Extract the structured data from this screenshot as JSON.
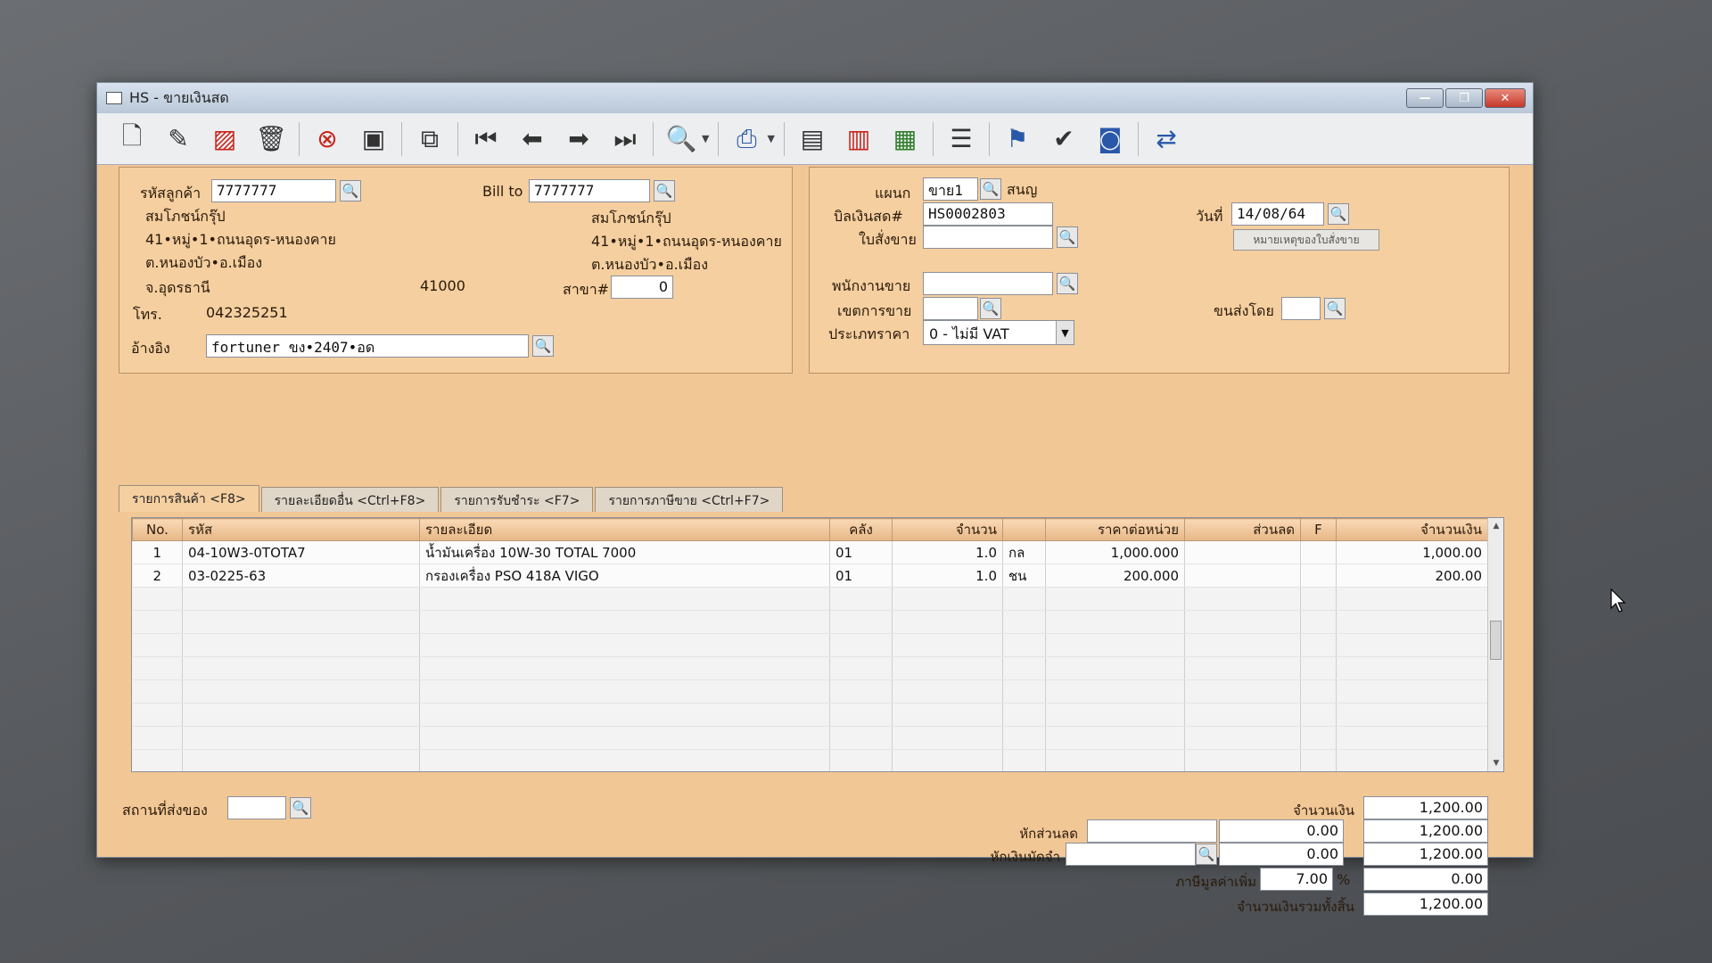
{
  "window": {
    "title": "HS - ขายเงินสด"
  },
  "toolbar": {
    "icons": [
      "new-icon",
      "edit-icon",
      "void-icon",
      "delete-icon",
      "cancel-icon",
      "save-icon",
      "copy-icon",
      "first-icon",
      "prev-icon",
      "next-icon",
      "last-icon",
      "search-icon",
      "print-icon",
      "calc-icon",
      "card-icon",
      "report-icon",
      "list-icon",
      "approve-icon",
      "checkmark-icon",
      "ok-icon",
      "transfer-icon"
    ]
  },
  "customer": {
    "code_label": "รหัสลูกค้า",
    "code": "7777777",
    "name": "สมโภชน์กรุ๊ป",
    "addr1": "41•หมู่•1•ถนนอุดร-หนองคาย",
    "addr2": "ต.หนองบัว•อ.เมือง",
    "province": "จ.อุดรธานี",
    "zip": "41000",
    "phone_label": "โทร.",
    "phone": "042325251",
    "ref_label": "อ้างอิง",
    "ref": "fortuner ขง•2407•อด"
  },
  "billto": {
    "label": "Bill to",
    "code": "7777777",
    "name": "สมโภชน์กรุ๊ป",
    "addr1": "41•หมู่•1•ถนนอุดร-หนองคาย",
    "addr2": "ต.หนองบัว•อ.เมือง",
    "branch_label": "สาขา#",
    "branch": "0"
  },
  "doc": {
    "dept_label": "แผนก",
    "dept": "ขาย1",
    "dept_name": "สนญ",
    "bill_label": "บิลเงินสด#",
    "bill": "HS0002803",
    "date_label": "วันที่",
    "date": "14/08/64",
    "so_label": "ใบสั่งขาย",
    "so_note_button": "หมายเหตุของใบสั่งขาย",
    "sales_label": "พนักงานขาย",
    "area_label": "เขตการขาย",
    "ship_label": "ขนส่งโดย",
    "price_type_label": "ประเภทราคา",
    "price_type": "0 - ไม่มี VAT"
  },
  "tabs": [
    {
      "label": "รายการสินค้า <F8>"
    },
    {
      "label": "รายละเอียดอื่น <Ctrl+F8>"
    },
    {
      "label": "รายการรับชำระ <F7>"
    },
    {
      "label": "รายการภาษีขาย <Ctrl+F7>"
    }
  ],
  "grid": {
    "columns": [
      "No.",
      "รหัส",
      "รายละเอียด",
      "คลัง",
      "จำนวน",
      "",
      "ราคาต่อหน่วย",
      "ส่วนลด",
      "F",
      "จำนวนเงิน"
    ],
    "rows": [
      {
        "no": "1",
        "code": "04-10W3-0TOTA7",
        "desc": "น้ำมันเครื่อง 10W-30 TOTAL 7000",
        "wh": "01",
        "qty": "1.0",
        "unit": "กล",
        "price": "1,000.000",
        "disc": "",
        "f": "",
        "amount": "1,000.00"
      },
      {
        "no": "2",
        "code": "03-0225-63",
        "desc": "กรองเครื่อง PSO 418A VIGO",
        "wh": "01",
        "qty": "1.0",
        "unit": "ชน",
        "price": "200.000",
        "disc": "",
        "f": "",
        "amount": "200.00"
      }
    ]
  },
  "footer": {
    "ship_place_label": "สถานที่ส่งของ",
    "amount_label": "จำนวนเงิน",
    "amount": "1,200.00",
    "discount_label": "หักส่วนลด",
    "discount": "0.00",
    "after_discount": "1,200.00",
    "deposit_label": "หักเงินมัดจำ",
    "deposit": "0.00",
    "after_deposit": "1,200.00",
    "vat_label": "ภาษีมูลค่าเพิ่ม",
    "vat_rate": "7.00",
    "vat_pct": "%",
    "vat": "0.00",
    "grand_label": "จำนวนเงินรวมทั้งสิ้น",
    "grand_total": "1,200.00"
  }
}
